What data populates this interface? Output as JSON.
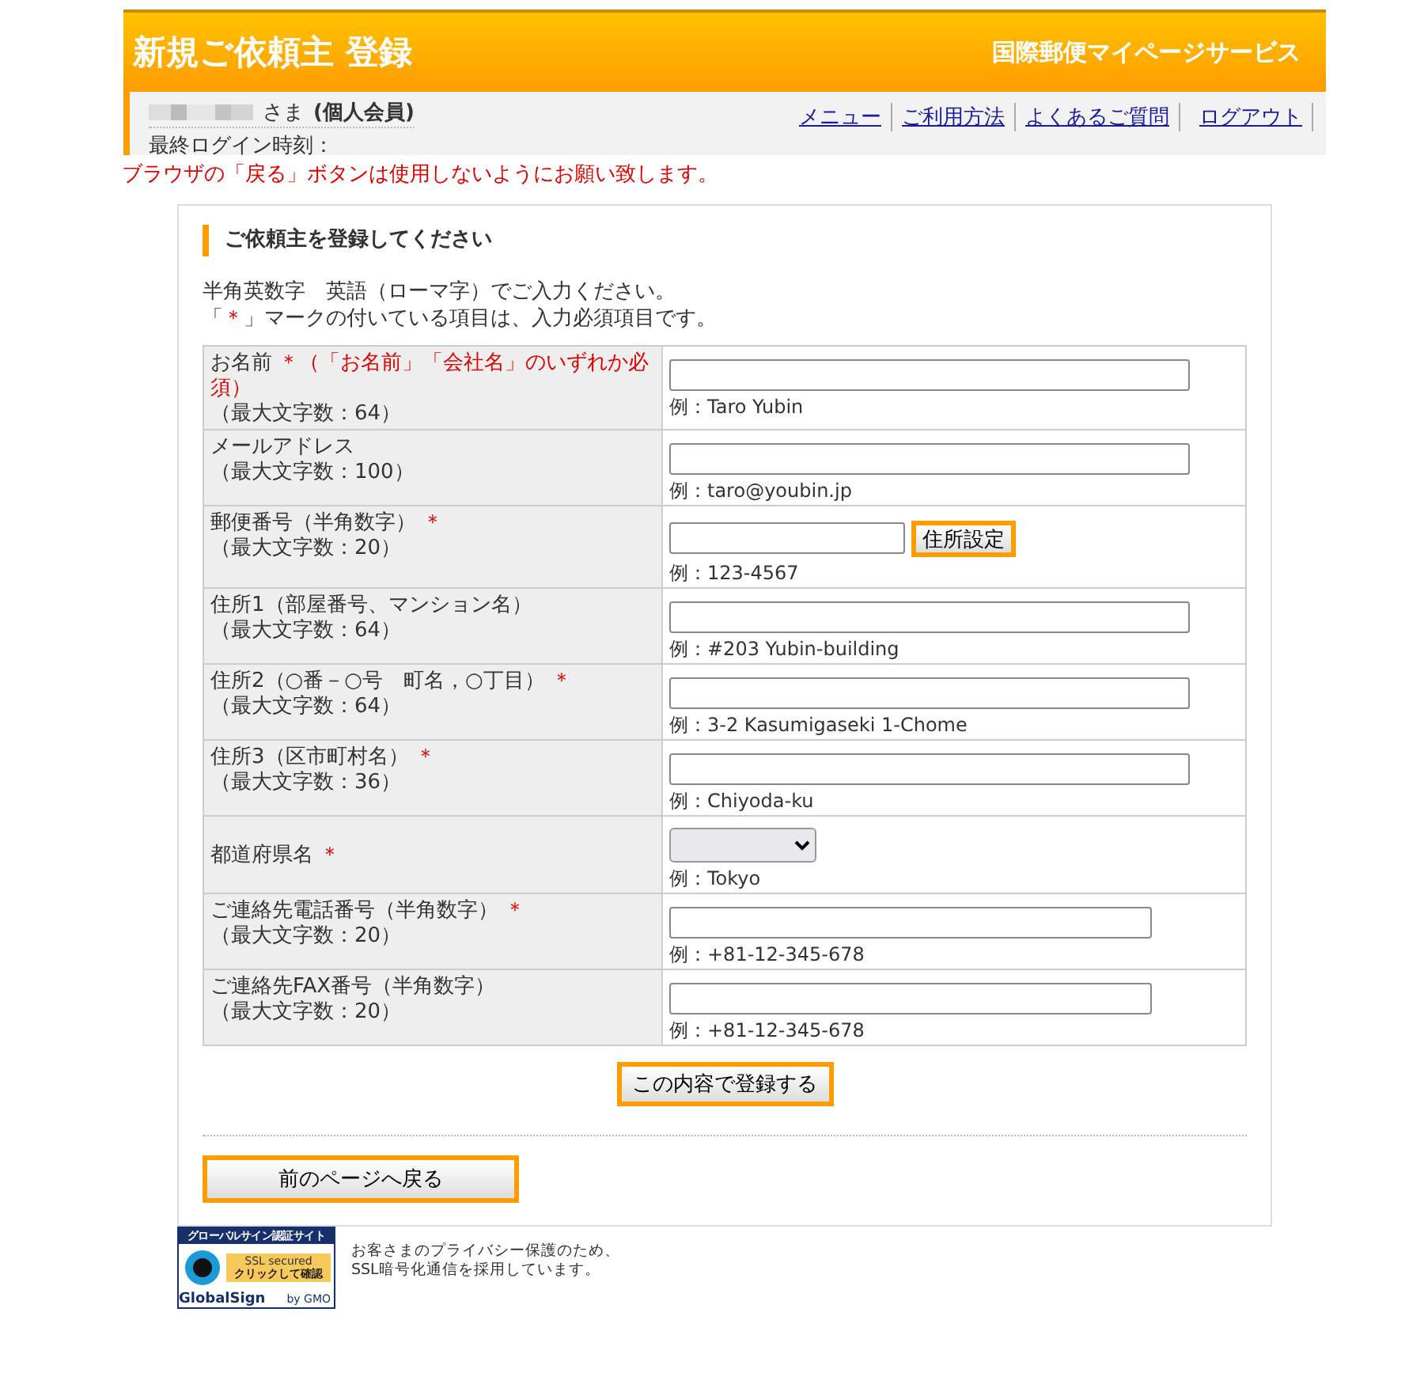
{
  "header": {
    "title": "新規ご依頼主 登録",
    "service": "国際郵便マイページサービス"
  },
  "userbar": {
    "honorific": "さま",
    "member_type": "(個人会員)",
    "last_login": "最終ログイン時刻：",
    "links": [
      "メニュー",
      "ご利用方法",
      "よくあるご質問",
      "ログアウト"
    ]
  },
  "warning": "ブラウザの「戻る」ボタンは使用しないようにお願い致します。",
  "form": {
    "heading": "ご依頼主を登録してください",
    "intro": "半角英数字　英語（ローマ字）でご入力ください。",
    "required_note": [
      {
        "kind": "plain",
        "text": "「"
      },
      {
        "kind": "mark",
        "text": "＊"
      },
      {
        "kind": "plain",
        "text": "」マークの付いている項目は、入力必須項目です。"
      }
    ],
    "rows": [
      {
        "label": "お名前",
        "mark": "＊",
        "note": "（「お名前」「会社名」のいずれか必須）",
        "max": "（最大文字数：64）",
        "kind": "long",
        "example": "例：Taro Yubin"
      },
      {
        "label": "メールアドレス",
        "max": "（最大文字数：100）",
        "kind": "long",
        "example": "例：taro@youbin.jp"
      },
      {
        "label": "郵便番号（半角数字）",
        "mark": "＊",
        "max": "（最大文字数：20）",
        "kind": "short",
        "button": "住所設定",
        "example": "例：123-4567"
      },
      {
        "label": "住所1（部屋番号、マンション名）",
        "max": "（最大文字数：64）",
        "kind": "long",
        "example": "例：#203 Yubin-building"
      },
      {
        "label": "住所2（○番－○号　町名，○丁目）",
        "mark": "＊",
        "max": "（最大文字数：64）",
        "kind": "long",
        "example": "例：3-2 Kasumigaseki 1-Chome"
      },
      {
        "label": "住所3（区市町村名）",
        "mark": "＊",
        "max": "（最大文字数：36）",
        "kind": "long",
        "example": "例：Chiyoda-ku"
      },
      {
        "label": "都道府県名",
        "mark": "＊",
        "kind": "select",
        "example": "例：Tokyo"
      },
      {
        "label": "ご連絡先電話番号（半角数字）",
        "mark": "＊",
        "max": "（最大文字数：20）",
        "kind": "medium",
        "example": "例：+81-12-345-678"
      },
      {
        "label": "ご連絡先FAX番号（半角数字）",
        "max": "（最大文字数：20）",
        "kind": "medium",
        "example": "例：+81-12-345-678"
      }
    ],
    "submit": "この内容で登録する",
    "back": "前のページへ戻る"
  },
  "footer": {
    "seal": {
      "top": "グローバルサイン認証サイト",
      "ssl": "SSL secured",
      "check": "クリックして確認",
      "brand": "GlobalSign",
      "by": "by GMO"
    },
    "text": "お客さまのプライバシー保護のため、\nSSL暗号化通信を採用しています。"
  }
}
